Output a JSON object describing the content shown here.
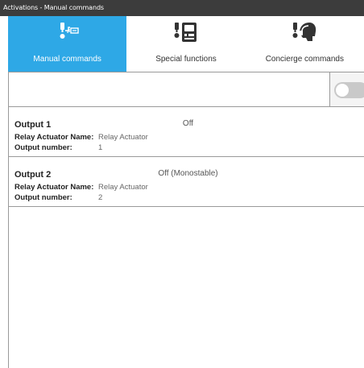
{
  "window": {
    "title": "Activations - Manual commands"
  },
  "tabs": [
    {
      "label": "Manual commands",
      "icon": "manual-commands-icon",
      "active": true
    },
    {
      "label": "Special functions",
      "icon": "special-functions-icon",
      "active": false
    },
    {
      "label": "Concierge commands",
      "icon": "concierge-commands-icon",
      "active": false
    }
  ],
  "search": {
    "value": "",
    "placeholder": ""
  },
  "filter_toggle": {
    "on": false
  },
  "outputs": [
    {
      "title": "Output 1",
      "state": "Off",
      "name_label": "Relay Actuator Name:",
      "name_value": "Relay Actuator",
      "number_label": "Output number:",
      "number_value": "1"
    },
    {
      "title": "Output 2",
      "state": "Off (Monostable)",
      "name_label": "Relay Actuator Name:",
      "name_value": "Relay Actuator",
      "number_label": "Output number:",
      "number_value": "2"
    }
  ],
  "colors": {
    "accent": "#2ea8e6",
    "titlebar": "#3c3c3c",
    "divider": "#9a9a9a"
  }
}
